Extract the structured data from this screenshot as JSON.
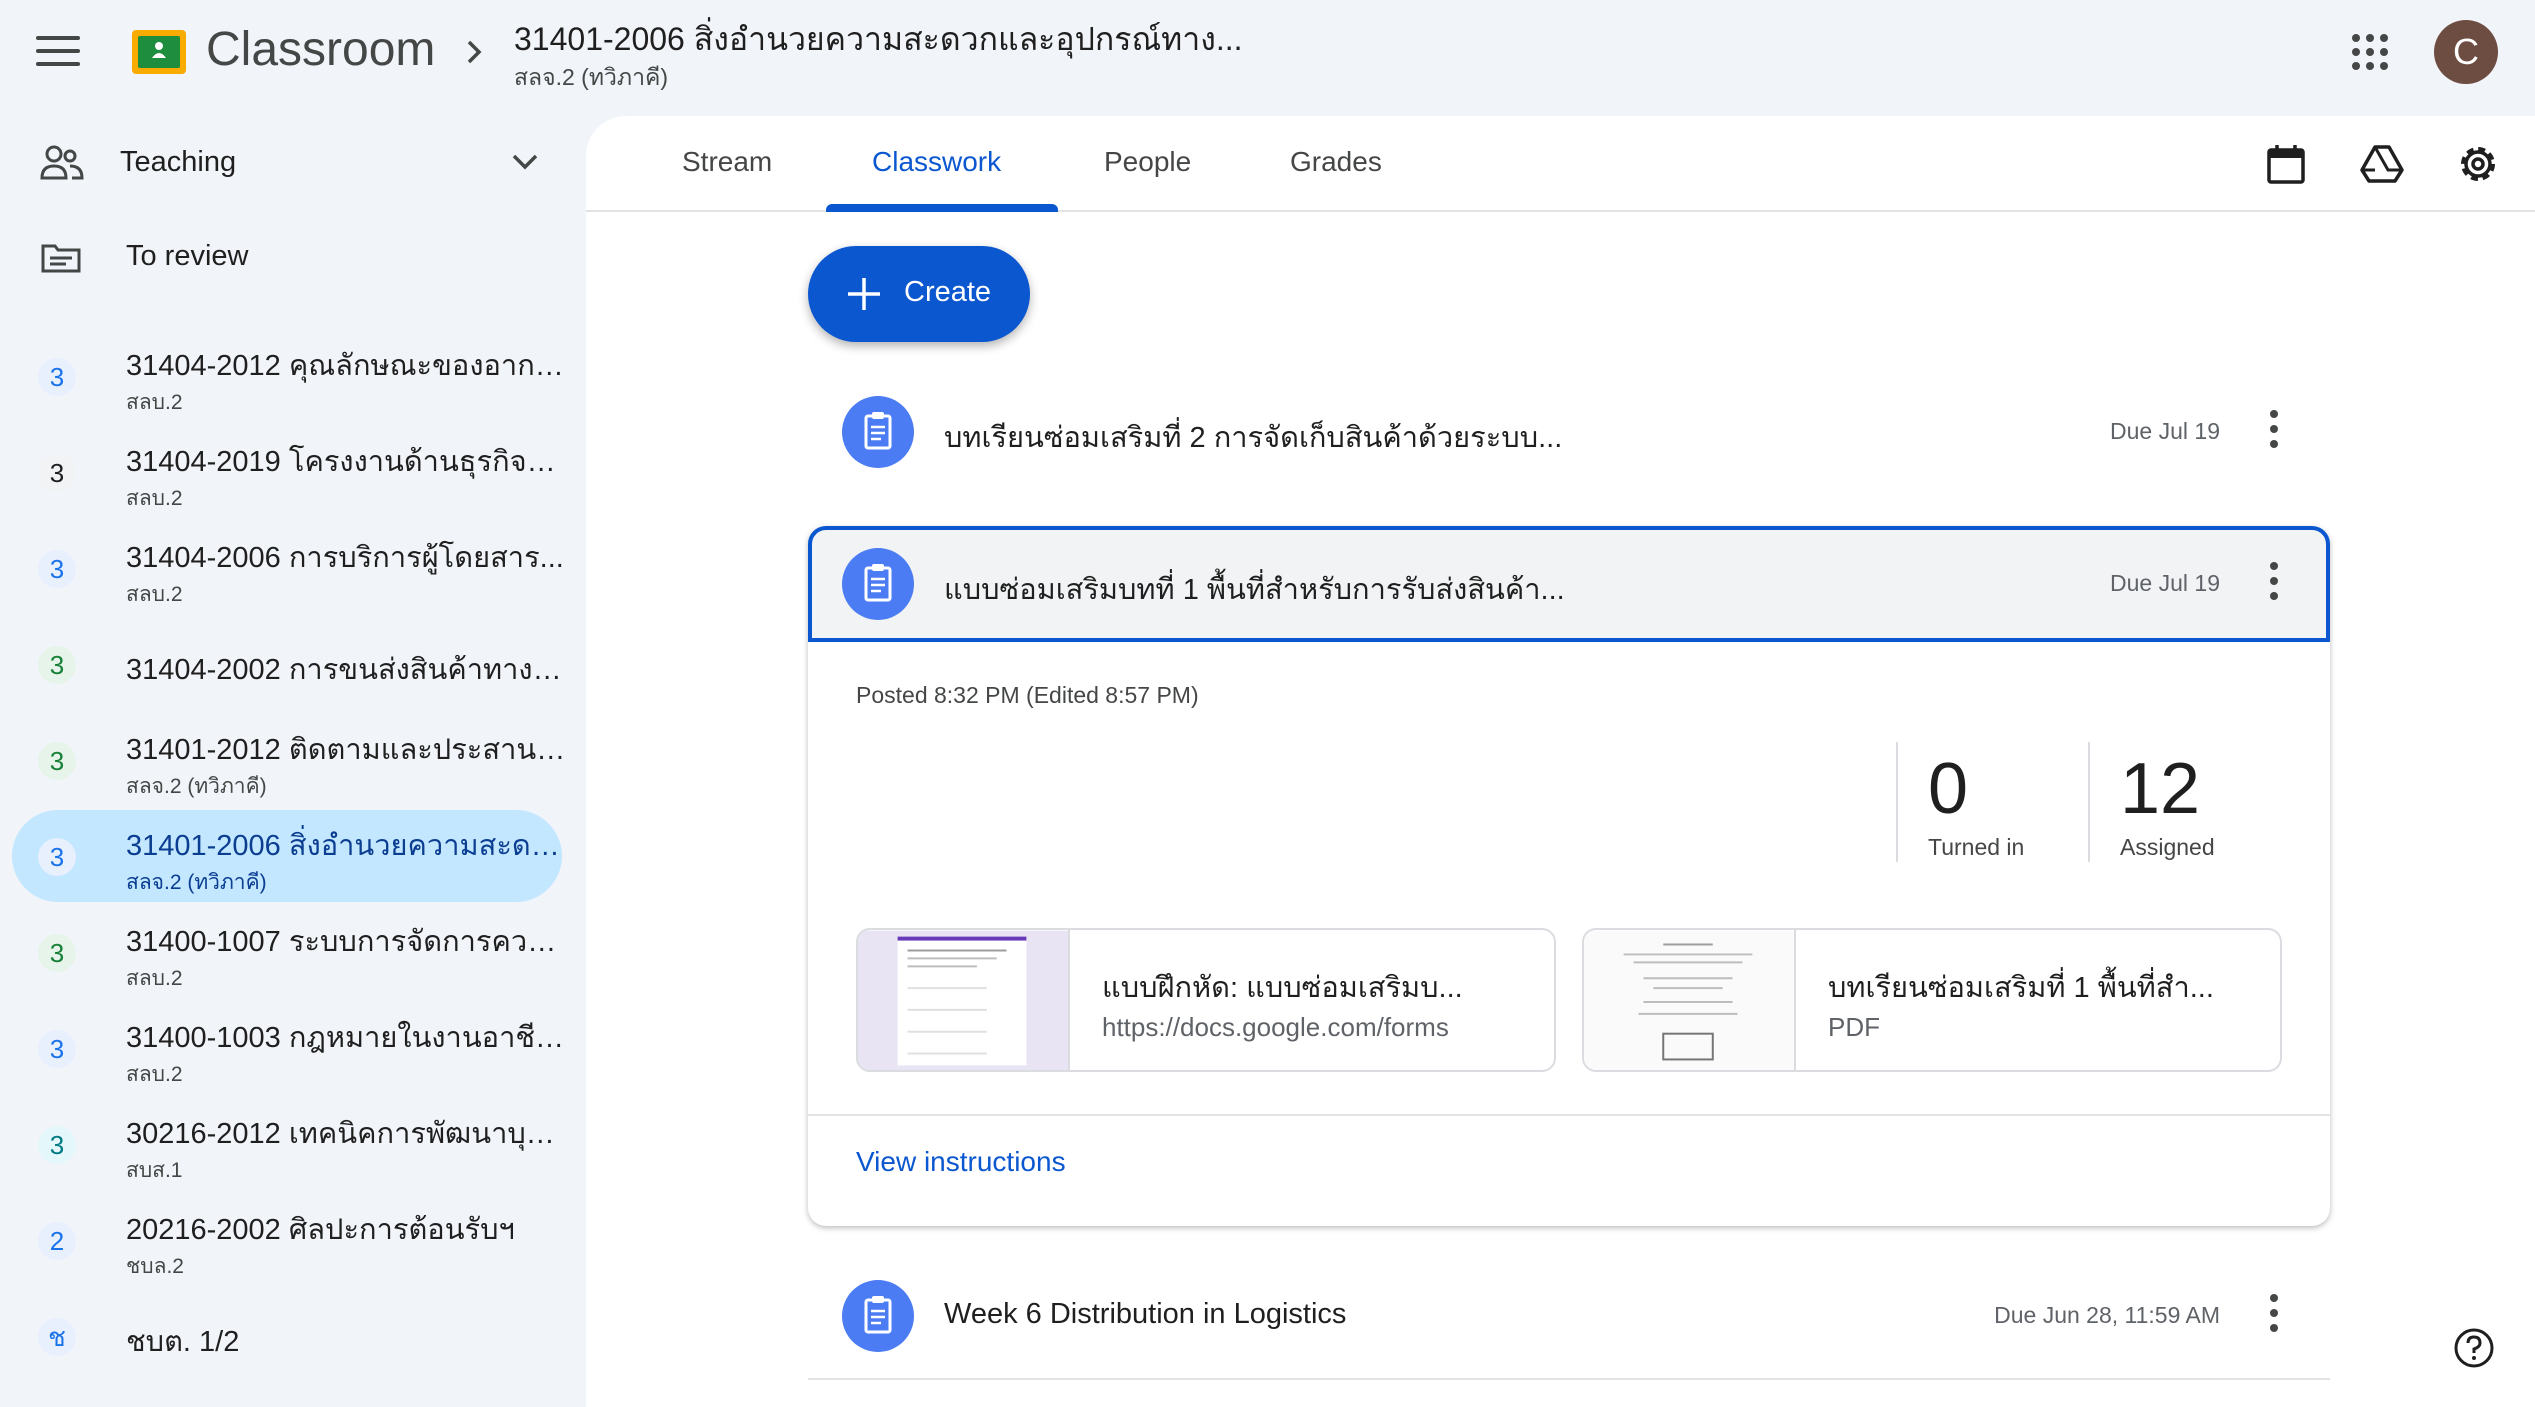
{
  "header": {
    "app_name": "Classroom",
    "course_title": "31401-2006 สิ่งอำนวยความสะดวกและอุปกรณ์ทาง...",
    "course_section": "สลจ.2 (ทวิภาคี)",
    "avatar_letter": "C"
  },
  "sidebar": {
    "teaching_label": "Teaching",
    "to_review_label": "To review",
    "classes": [
      {
        "badge": "3",
        "color": "blue",
        "name": "31404-2012 คุณลักษณะของอากา...",
        "section": "สลบ.2"
      },
      {
        "badge": "3",
        "color": "grey",
        "name": "31404-2019 โครงงานด้านธุรกิจกา...",
        "section": "สลบ.2"
      },
      {
        "badge": "3",
        "color": "blue",
        "name": "31404-2006 การบริการผู้โดยสาร...",
        "section": "สลบ.2"
      },
      {
        "badge": "3",
        "color": "green",
        "name": "31404-2002 การขนส่งสินค้าทางอ...",
        "section": ""
      },
      {
        "badge": "3",
        "color": "green",
        "name": "31401-2012 ติดตามและประสานงา...",
        "section": "สลจ.2 (ทวิภาคี)"
      },
      {
        "badge": "3",
        "color": "blue",
        "name": "31401-2006 สิ่งอำนวยความสะดว...",
        "section": "สลจ.2 (ทวิภาคี)"
      },
      {
        "badge": "3",
        "color": "green",
        "name": "31400-1007 ระบบการจัดการความ...",
        "section": "สลบ.2"
      },
      {
        "badge": "3",
        "color": "blue",
        "name": "31400-1003 กฎหมายในงานอาชีพ...",
        "section": "สลบ.2"
      },
      {
        "badge": "3",
        "color": "teal",
        "name": "30216-2012 เทคนิคการพัฒนาบุค...",
        "section": "สบส.1"
      },
      {
        "badge": "2",
        "color": "blue",
        "name": "20216-2002 ศิลปะการต้อนรับฯ",
        "section": "ชบล.2"
      },
      {
        "badge": "ช",
        "color": "blue",
        "name": "ชบต. 1/2",
        "section": ""
      }
    ]
  },
  "tabs": [
    "Stream",
    "Classwork",
    "People",
    "Grades"
  ],
  "create_label": "Create",
  "classwork": {
    "items": [
      {
        "title": "บทเรียนซ่อมเสริมที่ 2 การจัดเก็บสินค้าด้วยระบบ...",
        "due": "Due Jul 19"
      },
      {
        "title": "แบบซ่อมเสริมบทที่ 1 พื้นที่สำหรับการรับส่งสินค้า...",
        "due": "Due Jul 19"
      },
      {
        "title": "Week 6 Distribution in Logistics",
        "due": "Due Jun 28, 11:59 AM"
      }
    ],
    "expanded": {
      "posted": "Posted 8:32 PM (Edited 8:57 PM)",
      "turned_in_count": "0",
      "turned_in_label": "Turned in",
      "assigned_count": "12",
      "assigned_label": "Assigned",
      "attachments": [
        {
          "title": "แบบฝึกหัด: แบบซ่อมเสริมบ...",
          "subtitle": "https://docs.google.com/forms"
        },
        {
          "title": "บทเรียนซ่อมเสริมที่ 1 พื้นที่สำ...",
          "subtitle": "PDF"
        }
      ],
      "view_instructions": "View instructions"
    }
  },
  "colors": {
    "accent": "#0b57d0",
    "active_bg": "#c2e7ff",
    "assignment_icon": "#4c7cf3"
  },
  "icons": [
    "menu-icon",
    "classroom-logo",
    "chevron-right-icon",
    "apps-grid-icon",
    "teaching-icon",
    "chevron-down-icon",
    "to-review-icon",
    "plus-icon",
    "assignment-icon",
    "more-vert-icon",
    "calendar-icon",
    "drive-icon",
    "settings-icon",
    "help-icon"
  ]
}
